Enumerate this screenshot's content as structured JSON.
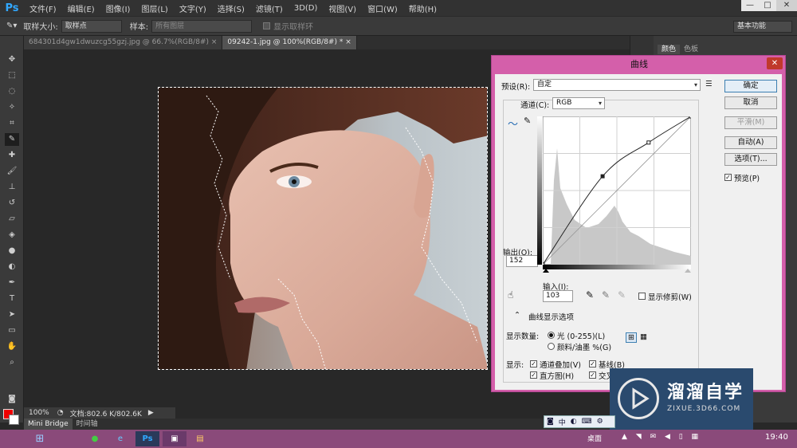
{
  "app": {
    "logo": "Ps"
  },
  "menu": [
    "文件(F)",
    "编辑(E)",
    "图像(I)",
    "图层(L)",
    "文字(Y)",
    "选择(S)",
    "滤镜(T)",
    "3D(D)",
    "视图(V)",
    "窗口(W)",
    "帮助(H)"
  ],
  "window_controls": {
    "minimize": "—",
    "restore": "□",
    "close": "✕"
  },
  "options_bar": {
    "sample_size_label": "取样大小:",
    "sample_size_value": "取样点",
    "sample_label": "样本:",
    "sample_value": "所有图层",
    "show_ring_label": "显示取样环",
    "workspace": "基本功能"
  },
  "tabs": [
    {
      "label": "684301d4gw1dwuzcg55gzj.jpg @ 66.7%(RGB/8#)",
      "close": "×"
    },
    {
      "label": "09242-1.jpg @ 100%(RGB/8#) *",
      "close": "×"
    }
  ],
  "right_tabs": [
    "颜色",
    "色板"
  ],
  "status": {
    "zoom": "100%",
    "doc": "文档:802.6 K/802.6K"
  },
  "bottom_tabs": [
    "Mini Bridge",
    "时间轴"
  ],
  "dialog": {
    "title": "曲线",
    "close": "✕",
    "preset_label": "预设(R):",
    "preset_value": "自定",
    "channel_label": "通道(C):",
    "channel_value": "RGB",
    "output_label": "输出(O):",
    "output_value": "152",
    "input_label": "输入(I):",
    "input_value": "103",
    "show_clipping": "显示修剪(W)",
    "display_options": "曲线显示选项",
    "show_amount_label": "显示数量:",
    "light_option": "光 (0-255)(L)",
    "pigment_option": "颜料/油墨 %(G)",
    "show_label": "显示:",
    "channel_overlay": "通道叠加(V)",
    "baseline": "基线(B)",
    "histogram": "直方图(H)",
    "intersection": "交叉线(N)",
    "buttons": {
      "ok": "确定",
      "cancel": "取消",
      "smooth": "平滑(M)",
      "auto": "自动(A)",
      "options": "选项(T)..."
    },
    "preview": "预览(P)"
  },
  "curve_points": [
    [
      0,
      0
    ],
    [
      103,
      152
    ],
    [
      182,
      210
    ],
    [
      255,
      255
    ]
  ],
  "watermark": {
    "title": "溜溜自学",
    "url": "ZIXUE.3D66.COM"
  },
  "ime": {
    "mode": "中"
  },
  "taskbar": {
    "desktop": "桌面",
    "clock": "19:40"
  }
}
